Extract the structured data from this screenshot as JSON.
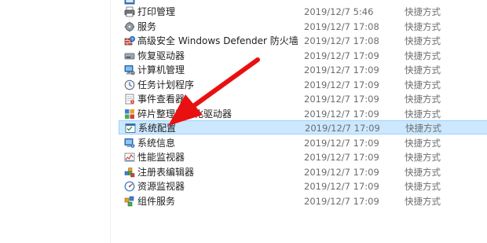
{
  "file_list": {
    "rows": [
      {
        "name": "",
        "date": "",
        "type": "",
        "icon": "shortcut-icon"
      },
      {
        "name": "打印管理",
        "date": "2019/12/7 5:46",
        "type": "快捷方式",
        "icon": "print-management-icon"
      },
      {
        "name": "服务",
        "date": "2019/12/7 17:08",
        "type": "快捷方式",
        "icon": "services-icon"
      },
      {
        "name": "高级安全 Windows Defender 防火墙",
        "date": "2019/12/7 17:08",
        "type": "快捷方式",
        "icon": "firewall-icon"
      },
      {
        "name": "恢复驱动器",
        "date": "2019/12/7 17:09",
        "type": "快捷方式",
        "icon": "recovery-drive-icon"
      },
      {
        "name": "计算机管理",
        "date": "2019/12/7 17:09",
        "type": "快捷方式",
        "icon": "computer-management-icon"
      },
      {
        "name": "任务计划程序",
        "date": "2019/12/7 17:09",
        "type": "快捷方式",
        "icon": "task-scheduler-icon"
      },
      {
        "name": "事件查看器",
        "date": "2019/12/7 17:09",
        "type": "快捷方式",
        "icon": "event-viewer-icon"
      },
      {
        "name": "碎片整理和优化驱动器",
        "date": "2019/12/7 17:09",
        "type": "快捷方式",
        "icon": "defragment-icon"
      },
      {
        "name": "系统配置",
        "date": "2019/12/7 17:09",
        "type": "快捷方式",
        "icon": "system-configuration-icon",
        "selected": true
      },
      {
        "name": "系统信息",
        "date": "2019/12/7 17:09",
        "type": "快捷方式",
        "icon": "system-information-icon"
      },
      {
        "name": "性能监视器",
        "date": "2019/12/7 17:09",
        "type": "快捷方式",
        "icon": "performance-monitor-icon"
      },
      {
        "name": "注册表编辑器",
        "date": "2019/12/7 17:09",
        "type": "快捷方式",
        "icon": "registry-editor-icon"
      },
      {
        "name": "资源监视器",
        "date": "2019/12/7 17:09",
        "type": "快捷方式",
        "icon": "resource-monitor-icon"
      },
      {
        "name": "组件服务",
        "date": "2019/12/7 17:09",
        "type": "快捷方式",
        "icon": "component-services-icon"
      }
    ]
  },
  "colors": {
    "selection_background": "#cce8ff",
    "selection_border": "#99d1ff",
    "annotation_arrow": "#e81010"
  }
}
